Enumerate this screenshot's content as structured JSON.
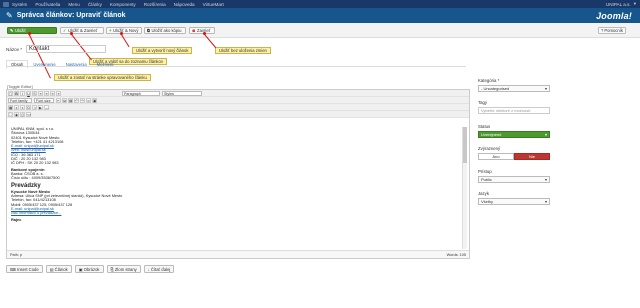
{
  "topnav": {
    "items": [
      "Systém",
      "Používatelia",
      "Menu",
      "Články",
      "Komponenty",
      "Rozšírenia",
      "Nápoveda",
      "VirtueMart"
    ],
    "user": "UNIPAL a.s."
  },
  "titlebar": {
    "title": "Správca článkov: Upraviť článok",
    "logo": "Joomla!"
  },
  "toolbar": {
    "save": "Uložiť",
    "save_close": "Uložiť & Zavrieť",
    "save_new": "Uložiť & Nový",
    "save_copy": "Uložiť ako kópiu",
    "close": "Zavrieť",
    "help": "Pomocník"
  },
  "notes": {
    "save_new": "Uložiť a vytvoriť nový článok",
    "close": "Uložiť bez uloženia zmien",
    "save_close": "Uložiť a vrátiť sa do zoznamu článkov",
    "save": "Uložiť a zostať na stránke upravovaného článku"
  },
  "form": {
    "name_label": "Názov *",
    "name_value": "Kontakt"
  },
  "tabs": [
    "Obsah",
    "Uverejnenie",
    "Nastavenia",
    "Možnosti"
  ],
  "editor": {
    "toggle": "[Toggle Editor]",
    "font_family": "Font family",
    "font_size": "Font size",
    "format": "Paragraph",
    "styles": "Styles",
    "content": [
      {
        "t": "UNIPAL KNM, spol. s r.o."
      },
      {
        "t": "Štúrova 1305/44"
      },
      {
        "t": "02401 Kysucké Nové Mesto"
      },
      {
        "t": " "
      },
      {
        "t": "Telefón, fax: +421 41 4213108"
      },
      {
        "t": "E-mail: unipal@unipal.sk",
        "link": true
      },
      {
        "t": "Web: www.unipal.sk",
        "link": true
      },
      {
        "t": " "
      },
      {
        "t": "IČO : 36 383 171"
      },
      {
        "t": "DIČ : 20 20 132 983"
      },
      {
        "t": "IČ DPH : SK 20 20 132 983"
      },
      {
        "t": "Bankové spojenie:",
        "h": true
      },
      {
        "t": "Banka: ČSOB a. s."
      },
      {
        "t": "Číslo účtu : 4009/3536/7500"
      },
      {
        "t": "Prevádzky",
        "big": true
      },
      {
        "t": "Kysucké Nové Mesto",
        "h": true
      },
      {
        "t": "Adresa: Ulica SNP (pri železničnej stanici), Kysucké Nové Mesto"
      },
      {
        "t": "Telefón, fax: 041/4213108"
      },
      {
        "t": "Mobil: 0905/437 125, 0905/437 128"
      },
      {
        "t": "E-mail: unipal@unipal.sk",
        "link": true
      },
      {
        "t": "viac informácií o prevádzke...",
        "link": true
      },
      {
        "t": "Rajec",
        "h": true
      }
    ],
    "path": "Path: p",
    "words": "Words: 105"
  },
  "bottom_buttons": [
    "Insert Code",
    "Článok",
    "Obrázok",
    "Zlom strany",
    "Čítať ďalej"
  ],
  "sidebar": {
    "category_label": "Kategória *",
    "category_value": "- Uncategorised",
    "tags_label": "Tagy",
    "tags_placeholder": "Vyberte niektoré z možností",
    "status_label": "Status",
    "status_value": "Uverejnené",
    "featured_label": "Zvýraznený",
    "featured_yes": "Áno",
    "featured_no": "Nie",
    "access_label": "Prístup",
    "access_value": "Public",
    "language_label": "Jazyk",
    "language_value": "Všetky"
  },
  "colors": {
    "accent_blue": "#17568c",
    "save_green": "#4e9a2f",
    "note_yellow": "#fdf1a8",
    "arrow_red": "#dd1111"
  }
}
